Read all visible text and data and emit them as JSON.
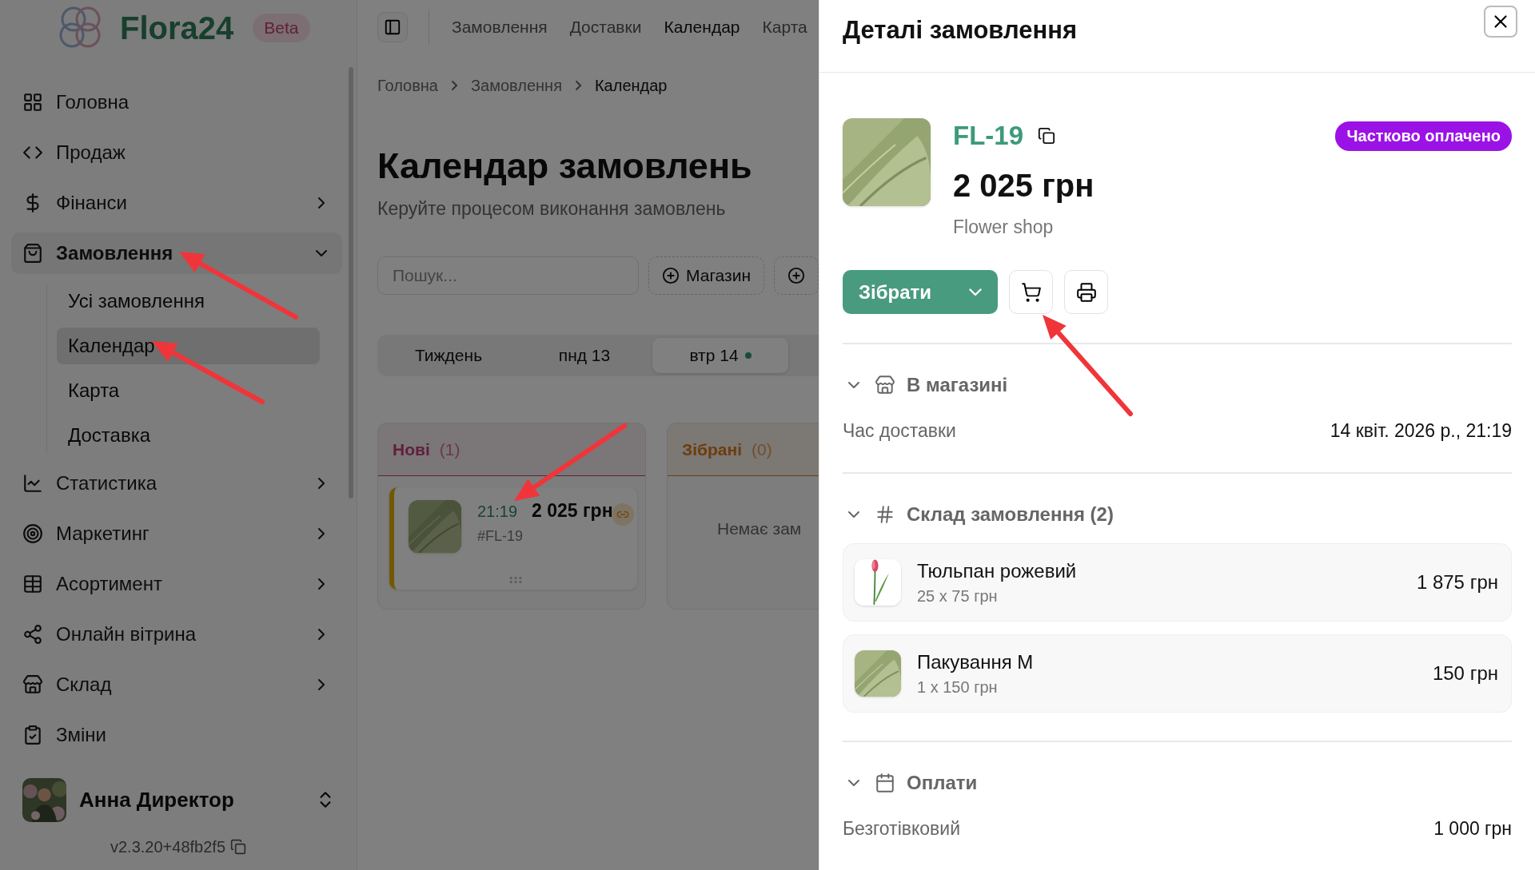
{
  "logo": {
    "text": "Flora24",
    "badge": "Beta"
  },
  "sidebar": {
    "items": [
      {
        "label": "Головна",
        "kind": "link",
        "selected": false
      },
      {
        "label": "Продаж",
        "kind": "link",
        "selected": false
      },
      {
        "label": "Фінанси",
        "kind": "group",
        "selected": false,
        "expanded": false
      },
      {
        "label": "Замовлення",
        "kind": "group",
        "selected": true,
        "expanded": true,
        "children": [
          {
            "label": "Усі замовлення",
            "selected": false
          },
          {
            "label": "Календар",
            "selected": true
          },
          {
            "label": "Карта",
            "selected": false
          },
          {
            "label": "Доставка",
            "selected": false
          }
        ]
      },
      {
        "label": "Статистика",
        "kind": "group",
        "selected": false,
        "expanded": false
      },
      {
        "label": "Маркетинг",
        "kind": "group",
        "selected": false,
        "expanded": false
      },
      {
        "label": "Асортимент",
        "kind": "group",
        "selected": false,
        "expanded": false
      },
      {
        "label": "Онлайн вітрина",
        "kind": "group",
        "selected": false,
        "expanded": false
      },
      {
        "label": "Склад",
        "kind": "group",
        "selected": false,
        "expanded": false
      },
      {
        "label": "Зміни",
        "kind": "link",
        "selected": false
      }
    ],
    "user": {
      "name": "Анна Директор"
    },
    "version": "v2.3.20+48fb2f5"
  },
  "top_nav": [
    {
      "label": "Замовлення",
      "selected": false
    },
    {
      "label": "Доставки",
      "selected": false
    },
    {
      "label": "Календар",
      "selected": true
    },
    {
      "label": "Карта",
      "selected": false
    }
  ],
  "breadcrumb": [
    "Головна",
    "Замовлення",
    "Календар"
  ],
  "page": {
    "title": "Календар замовлень",
    "subtitle": "Керуйте процесом виконання замовлень"
  },
  "search": {
    "placeholder": "Пошук..."
  },
  "filters": [
    {
      "label": "Магазин"
    }
  ],
  "day_tabs": [
    {
      "label": "Тиждень",
      "selected": false,
      "today": false
    },
    {
      "label": "пнд 13",
      "selected": false,
      "today": false
    },
    {
      "label": "втр 14",
      "selected": true,
      "today": true
    }
  ],
  "columns": [
    {
      "title": "Нові",
      "count": "(1)",
      "kind": "new",
      "orders": [
        {
          "time": "21:19",
          "amount": "2 025 грн",
          "id": "#FL-19"
        }
      ]
    },
    {
      "title": "Зібрані",
      "count": "(0)",
      "kind": "collected",
      "empty_text": "Немає зам"
    }
  ],
  "drawer": {
    "title": "Деталі замовлення",
    "order": {
      "id": "FL-19",
      "price": "2 025 грн",
      "shop": "Flower shop",
      "status": {
        "label": "Частково оплачено",
        "color": "#9b12e6"
      }
    },
    "primary_action": "Зібрати",
    "sections": [
      {
        "kind": "delivery",
        "title": "В магазині",
        "expanded": true,
        "rows": [
          {
            "label": "Час доставки",
            "value": "14 квіт. 2026 р., 21:19"
          }
        ]
      },
      {
        "kind": "items",
        "title": "Склад замовлення (2)",
        "expanded": true,
        "items": [
          {
            "kind": "tulip",
            "name": "Тюльпан рожевий",
            "qty": "25 x 75 грн",
            "total": "1 875 грн"
          },
          {
            "kind": "wrap",
            "name": "Пакування M",
            "qty": "1 x 150 грн",
            "total": "150 грн"
          }
        ]
      },
      {
        "kind": "payments",
        "title": "Оплати",
        "expanded": true,
        "rows": [
          {
            "label": "Безготівковий",
            "value": "1 000 грн"
          }
        ]
      }
    ]
  }
}
